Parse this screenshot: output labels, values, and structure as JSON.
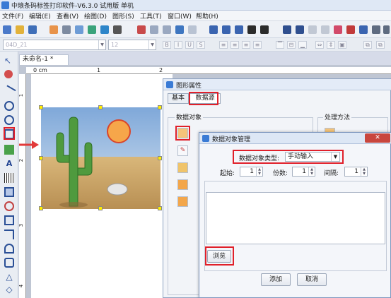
{
  "window": {
    "title": "中琅条码标签打印软件-V6.3.0 试用版 单机"
  },
  "menu": [
    "文件(F)",
    "编辑(E)",
    "查看(V)",
    "绘图(D)",
    "图形(S)",
    "工具(T)",
    "窗口(W)",
    "帮助(H)"
  ],
  "format_bar": {
    "font_value": "04D_21",
    "size_value": "12"
  },
  "document": {
    "tab_label": "未命名-1 *",
    "ruler": {
      "h0": "0 cm",
      "h1": "1",
      "h2": "2",
      "v1": "1",
      "v2": "2",
      "v3": "3",
      "v4": "4"
    }
  },
  "shape_dialog": {
    "title": "图形属性",
    "tabs": [
      "基本",
      "数据源"
    ],
    "data_object_label": "数据对象",
    "processing_label": "处理方法"
  },
  "manage_dialog": {
    "title": "数据对象管理",
    "close": "✕",
    "type_label": "数据对象类型:",
    "type_value": "手动输入",
    "start_label": "起始:",
    "start_value": "1",
    "copies_label": "份数:",
    "copies_value": "1",
    "interval_label": "间隔:",
    "interval_value": "1",
    "browse_label": "浏览",
    "add_label": "添加",
    "cancel_label": "取消"
  },
  "colors": {
    "highlight": "#e0202a",
    "accent": "#3a7bd5",
    "arrow": "#e23a3a"
  }
}
